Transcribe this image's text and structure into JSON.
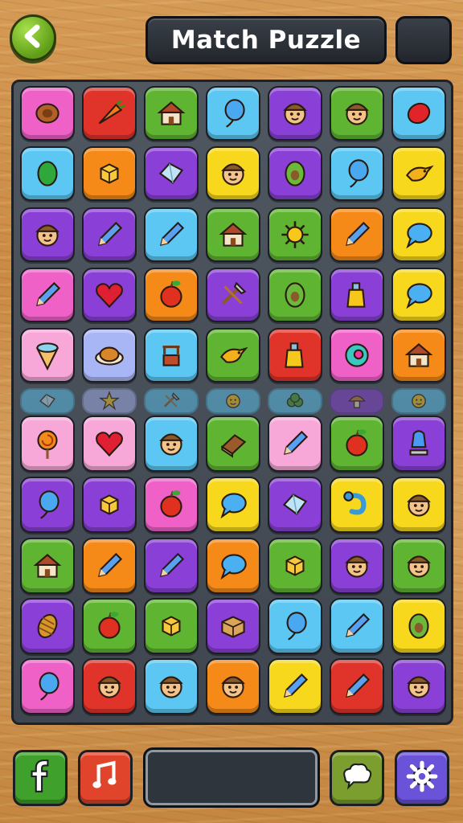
{
  "header": {
    "title": "Match Puzzle",
    "back_icon": "back-arrow-icon",
    "colors": {
      "bar": "#2a2f35",
      "back": "#7bbf2a"
    }
  },
  "board": {
    "colors": {
      "pink": "#f061c8",
      "red": "#e0332a",
      "green": "#5fb532",
      "blue": "#5bc7f2",
      "purple": "#8a3fd6",
      "yellow": "#f7d81c",
      "orange": "#f58a18",
      "lavender": "#a9b6f5",
      "lightpink": "#f7a8d8"
    },
    "rows": [
      {
        "tiles": [
          {
            "color": "pink",
            "icon": "nut-icon"
          },
          {
            "color": "red",
            "icon": "carrot-icon"
          },
          {
            "color": "green",
            "icon": "house-icon"
          },
          {
            "color": "blue",
            "icon": "balloon-icon"
          },
          {
            "color": "purple",
            "icon": "face-icon"
          },
          {
            "color": "green",
            "icon": "face-icon"
          },
          {
            "color": "blue",
            "icon": "berry-icon"
          }
        ]
      },
      {
        "tiles": [
          {
            "color": "blue",
            "icon": "leaf-icon"
          },
          {
            "color": "orange",
            "icon": "cube-icon"
          },
          {
            "color": "purple",
            "icon": "gem-icon"
          },
          {
            "color": "yellow",
            "icon": "face-icon"
          },
          {
            "color": "purple",
            "icon": "avocado-icon"
          },
          {
            "color": "blue",
            "icon": "balloon-icon"
          },
          {
            "color": "yellow",
            "icon": "bird-icon"
          }
        ]
      },
      {
        "tiles": [
          {
            "color": "purple",
            "icon": "face-icon"
          },
          {
            "color": "purple",
            "icon": "pencil-icon"
          },
          {
            "color": "blue",
            "icon": "pencil-icon"
          },
          {
            "color": "green",
            "icon": "house-icon"
          },
          {
            "color": "green",
            "icon": "sun-icon"
          },
          {
            "color": "orange",
            "icon": "pencil-icon"
          },
          {
            "color": "yellow",
            "icon": "speech-bubble-icon"
          }
        ]
      },
      {
        "tiles": [
          {
            "color": "pink",
            "icon": "pencil-icon"
          },
          {
            "color": "purple",
            "icon": "heart-icon"
          },
          {
            "color": "orange",
            "icon": "apple-icon"
          },
          {
            "color": "purple",
            "icon": "tools-icon"
          },
          {
            "color": "green",
            "icon": "avocado-icon"
          },
          {
            "color": "purple",
            "icon": "bottle-icon"
          },
          {
            "color": "yellow",
            "icon": "speech-bubble-icon"
          }
        ]
      },
      {
        "tiles": [
          {
            "color": "lightpink",
            "icon": "cone-icon"
          },
          {
            "color": "lavender",
            "icon": "bread-icon"
          },
          {
            "color": "blue",
            "icon": "well-icon"
          },
          {
            "color": "green",
            "icon": "bird-icon"
          },
          {
            "color": "red",
            "icon": "bottle-icon"
          },
          {
            "color": "pink",
            "icon": "donut-icon"
          },
          {
            "color": "orange",
            "icon": "house-icon"
          }
        ]
      },
      {
        "faded": true,
        "tiles": [
          {
            "color": "blue",
            "icon": "gem-icon"
          },
          {
            "color": "lavender",
            "icon": "star-icon"
          },
          {
            "color": "blue",
            "icon": "tools-icon"
          },
          {
            "color": "blue",
            "icon": "smiley-icon"
          },
          {
            "color": "blue",
            "icon": "bush-icon"
          },
          {
            "color": "purple",
            "icon": "mushroom-icon"
          },
          {
            "color": "blue",
            "icon": "smiley-icon"
          }
        ]
      },
      {
        "tiles": [
          {
            "color": "lightpink",
            "icon": "lollipop-icon"
          },
          {
            "color": "lightpink",
            "icon": "heart-icon"
          },
          {
            "color": "blue",
            "icon": "face-icon"
          },
          {
            "color": "green",
            "icon": "book-icon"
          },
          {
            "color": "lightpink",
            "icon": "pencil-icon"
          },
          {
            "color": "green",
            "icon": "apple-icon"
          },
          {
            "color": "purple",
            "icon": "lamp-icon"
          }
        ]
      },
      {
        "tiles": [
          {
            "color": "purple",
            "icon": "balloon-icon"
          },
          {
            "color": "purple",
            "icon": "cube-icon"
          },
          {
            "color": "pink",
            "icon": "apple-icon"
          },
          {
            "color": "yellow",
            "icon": "speech-bubble-icon"
          },
          {
            "color": "purple",
            "icon": "gem-icon"
          },
          {
            "color": "yellow",
            "icon": "snake-icon"
          },
          {
            "color": "yellow",
            "icon": "face-icon"
          }
        ]
      },
      {
        "tiles": [
          {
            "color": "green",
            "icon": "house-icon"
          },
          {
            "color": "orange",
            "icon": "pencil-icon"
          },
          {
            "color": "purple",
            "icon": "pencil-icon"
          },
          {
            "color": "orange",
            "icon": "speech-bubble-icon"
          },
          {
            "color": "green",
            "icon": "cube-icon"
          },
          {
            "color": "purple",
            "icon": "face-icon"
          },
          {
            "color": "green",
            "icon": "face-icon"
          }
        ]
      },
      {
        "tiles": [
          {
            "color": "purple",
            "icon": "pinecone-icon"
          },
          {
            "color": "green",
            "icon": "apple-icon"
          },
          {
            "color": "green",
            "icon": "cube-icon"
          },
          {
            "color": "purple",
            "icon": "box-icon"
          },
          {
            "color": "blue",
            "icon": "balloon-icon"
          },
          {
            "color": "blue",
            "icon": "pencil-icon"
          },
          {
            "color": "yellow",
            "icon": "avocado-icon"
          }
        ]
      },
      {
        "tiles": [
          {
            "color": "pink",
            "icon": "balloon-icon"
          },
          {
            "color": "red",
            "icon": "face-icon"
          },
          {
            "color": "blue",
            "icon": "face-icon"
          },
          {
            "color": "orange",
            "icon": "face-icon"
          },
          {
            "color": "yellow",
            "icon": "pencil-icon"
          },
          {
            "color": "red",
            "icon": "pencil-icon"
          },
          {
            "color": "purple",
            "icon": "face-icon"
          }
        ]
      }
    ]
  },
  "footer": {
    "buttons": [
      {
        "name": "facebook-button",
        "icon": "facebook-icon",
        "color": "#3fa12b"
      },
      {
        "name": "music-button",
        "icon": "music-note-icon",
        "color": "#e0442a"
      },
      {
        "name": "chat-button",
        "icon": "chat-cloud-icon",
        "color": "#7c9e2e"
      },
      {
        "name": "settings-button",
        "icon": "gear-icon",
        "color": "#6a52d9"
      }
    ],
    "panel": {
      "color": "#2f353c"
    }
  }
}
